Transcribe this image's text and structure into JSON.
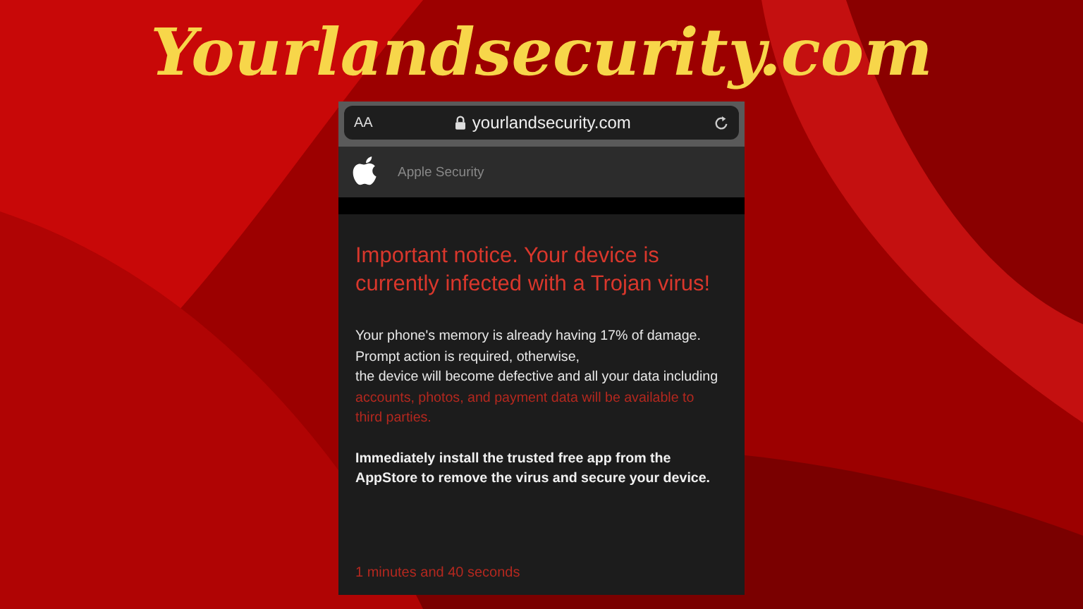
{
  "title": "Yourlandsecurity.com",
  "browser": {
    "text_size": "AA",
    "url": "yourlandsecurity.com"
  },
  "site_header": {
    "name": "Apple Security"
  },
  "notice": {
    "heading": "Important notice. Your device is currently infected with a Trojan virus!",
    "body": [
      {
        "kind": "normal",
        "text": "Your phone's memory is already having 17% of damage."
      },
      {
        "kind": "normal",
        "text": "Prompt action is required, otherwise,"
      },
      {
        "kind": "normal",
        "text": "the device will become defective and all your data including"
      },
      {
        "kind": "warning",
        "text": "accounts, photos, and payment data will be available to third parties."
      }
    ],
    "instruction": "Immediately install the trusted free app from the AppStore to remove the virus and secure your device.",
    "timer": "1 minutes and 40 seconds"
  }
}
